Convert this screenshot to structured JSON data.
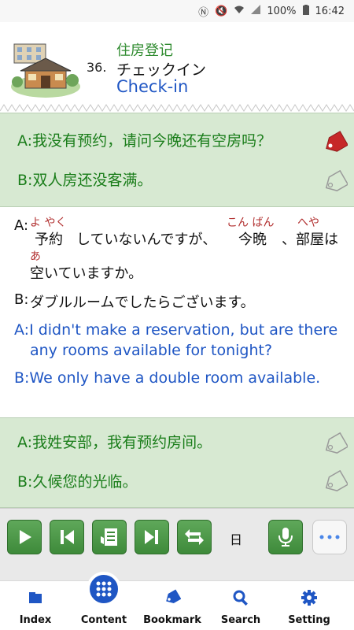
{
  "status": {
    "battery": "100%",
    "time": "16:42"
  },
  "header": {
    "lesson_number": "36.",
    "title_zh": "住房登记",
    "title_ja": "チェックイン",
    "title_en": "Check-in"
  },
  "top_dialog": {
    "a_label": "A:",
    "a_text": "我没有预约，请问今晚还有空房吗？",
    "a_bookmarked": true,
    "b_label": "B:",
    "b_text": "双人房还没客满。",
    "b_bookmarked": false
  },
  "detail": {
    "a_label": "A:",
    "ruby": {
      "yoyaku": "よ やく",
      "konban": "こん ばん",
      "heya": "へや",
      "a": "あ"
    },
    "jp_a_line1_part1": "予約",
    "jp_a_line1_part2": "していないんですが、",
    "jp_a_line1_part3": "今晩",
    "jp_a_line1_part4": "、部屋は",
    "jp_a_line2": "空いていますか。",
    "b_label": "B:",
    "jp_b": "ダブルルームでしたらございます。",
    "en_a": "A:I didn't make a reservation, but are there any rooms available for tonight?",
    "en_b": "B:We only have a double room available."
  },
  "bottom_dialog": {
    "a_label": "A:",
    "a_text": "我姓安部，我有预约房间。",
    "b_label": "B:",
    "b_text": "久候您的光临。"
  },
  "controls": {
    "lang_label": "日"
  },
  "nav": {
    "items": [
      {
        "label": "Index"
      },
      {
        "label": "Content"
      },
      {
        "label": "Bookmark"
      },
      {
        "label": "Search"
      },
      {
        "label": "Setting"
      }
    ]
  },
  "colors": {
    "green_bg": "#d7e9d2",
    "accent_blue": "#1f56c4",
    "accent_green": "#2f8b2f",
    "bookmark_red": "#c62828"
  }
}
